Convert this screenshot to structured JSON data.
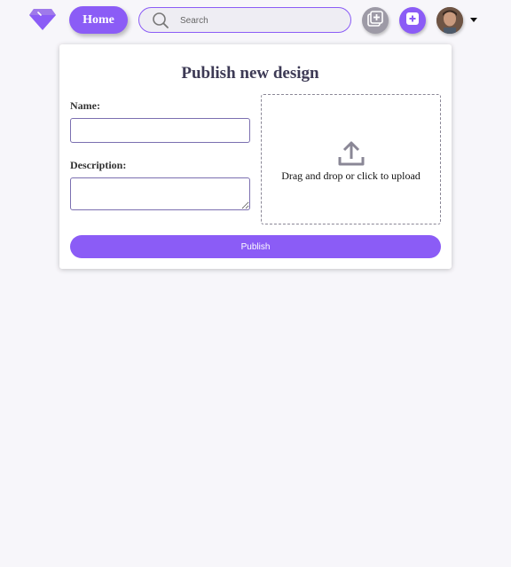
{
  "nav": {
    "home_label": "Home",
    "search_placeholder": "Search",
    "icons": [
      "diamond-logo-icon",
      "search-icon",
      "gallery-add-icon",
      "plus-square-icon",
      "caret-down-icon"
    ]
  },
  "form": {
    "title": "Publish new design",
    "name_label": "Name:",
    "name_value": "",
    "description_label": "Description:",
    "description_value": "",
    "upload_text": "Drag and drop or click to upload",
    "publish_label": "Publish"
  },
  "colors": {
    "accent": "#8b5cf6",
    "background": "#f7f6fa",
    "secondary_button": "#9d9aa6"
  }
}
